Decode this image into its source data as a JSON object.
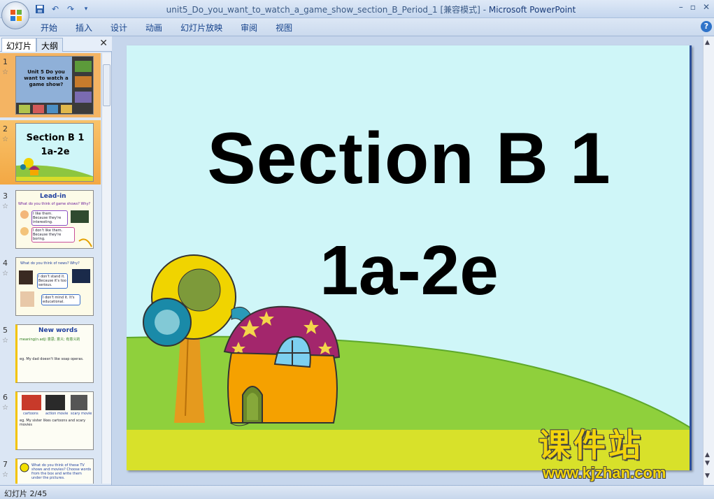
{
  "window": {
    "title_doc": "unit5_Do_you_want_to_watch_a_game_show_section_B_Period_1 [兼容模式]",
    "title_sep": " - ",
    "title_app": "Microsoft PowerPoint",
    "minimize": "–",
    "maximize": "▫",
    "close": "✕"
  },
  "quick_access": {
    "save_icon": "save-icon",
    "undo_icon": "undo-icon",
    "redo_icon": "redo-icon",
    "customize_icon": "customize-icon"
  },
  "ribbon": {
    "tabs": [
      "开始",
      "插入",
      "设计",
      "动画",
      "幻灯片放映",
      "审阅",
      "视图"
    ],
    "help": "?"
  },
  "left_panel": {
    "tab_slides": "幻灯片",
    "tab_outline": "大纲",
    "close": "✕",
    "thumbnails": [
      {
        "num": "1",
        "title": "Unit 5 Do you want to watch a game show?"
      },
      {
        "num": "2",
        "title": "Section B 1",
        "subtitle": "1a-2e"
      },
      {
        "num": "3",
        "header": "Lead-in",
        "q": "What do you think of game shows? Why?",
        "a1": "I like them. Because they're interesting.",
        "a2": "I don't like them. Because they're boring."
      },
      {
        "num": "4",
        "q": "What do you think of news? Why?",
        "a1": "I don't stand it. Because it's too serious.",
        "a2": "I don't mind it. It's educational."
      },
      {
        "num": "5",
        "header": "New words",
        "l1": "meaning(n.adj) 意思; 意义; 有意义的",
        "l2": "eg. My dad doesn't like soap operas."
      },
      {
        "num": "6",
        "c1": "cartoons",
        "c2": "action movie",
        "c3": "scary movie",
        "l1": "eg. My sister likes cartoons and scary movies"
      },
      {
        "num": "7",
        "l1": "What do you think of these TV shows and movies? Choose words from the box and write them under the pictures."
      }
    ]
  },
  "slide": {
    "title": "Section B 1",
    "subtitle": "1a-2e"
  },
  "watermark": {
    "cn": "课件站",
    "url": "www.kjzhan.com"
  },
  "status": {
    "text": "幻灯片 2/45"
  }
}
